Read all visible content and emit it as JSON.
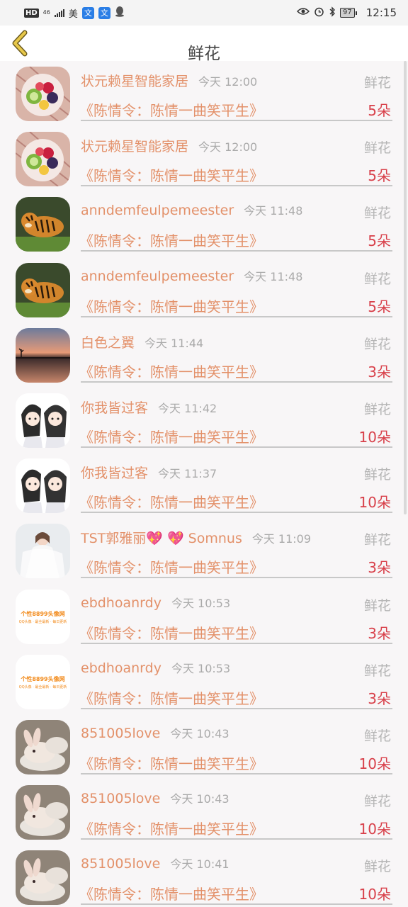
{
  "status_bar": {
    "hd": "HD",
    "net": "46",
    "carrier_text": "美",
    "app1": "文",
    "app2": "文",
    "battery": "97",
    "time": "12:15"
  },
  "header": {
    "title": "鲜花"
  },
  "type_label": "鲜花",
  "records": [
    {
      "name": "状元赖星智能家居",
      "time": "今天 12:00",
      "type": "鲜花",
      "work": "《陈情令：陈情一曲笑平生》",
      "count": "5朵",
      "avatar": "fruit"
    },
    {
      "name": "状元赖星智能家居",
      "time": "今天 12:00",
      "type": "鲜花",
      "work": "《陈情令：陈情一曲笑平生》",
      "count": "5朵",
      "avatar": "fruit"
    },
    {
      "name": "anndemfeulpemeester",
      "time": "今天 11:48",
      "type": "鲜花",
      "work": "《陈情令：陈情一曲笑平生》",
      "count": "5朵",
      "avatar": "tiger"
    },
    {
      "name": "anndemfeulpemeester",
      "time": "今天 11:48",
      "type": "鲜花",
      "work": "《陈情令：陈情一曲笑平生》",
      "count": "5朵",
      "avatar": "tiger"
    },
    {
      "name": "白色之翼",
      "time": "今天 11:44",
      "type": "鲜花",
      "work": "《陈情令：陈情一曲笑平生》",
      "count": "3朵",
      "avatar": "sunset"
    },
    {
      "name": "你我皆过客",
      "time": "今天 11:42",
      "type": "鲜花",
      "work": "《陈情令：陈情一曲笑平生》",
      "count": "10朵",
      "avatar": "anime"
    },
    {
      "name": "你我皆过客",
      "time": "今天 11:37",
      "type": "鲜花",
      "work": "《陈情令：陈情一曲笑平生》",
      "count": "10朵",
      "avatar": "anime"
    },
    {
      "name": "TST郭雅丽💖 💖 Somnus",
      "time": "今天 11:09",
      "type": "鲜花",
      "work": "《陈情令：陈情一曲笑平生》",
      "count": "3朵",
      "avatar": "bride"
    },
    {
      "name": "ebdhoanrdy",
      "time": "今天 10:53",
      "type": "鲜花",
      "work": "《陈情令：陈情一曲笑平生》",
      "count": "3朵",
      "avatar": "logo"
    },
    {
      "name": "ebdhoanrdy",
      "time": "今天 10:53",
      "type": "鲜花",
      "work": "《陈情令：陈情一曲笑平生》",
      "count": "3朵",
      "avatar": "logo"
    },
    {
      "name": "851005love",
      "time": "今天 10:43",
      "type": "鲜花",
      "work": "《陈情令：陈情一曲笑平生》",
      "count": "10朵",
      "avatar": "bunny"
    },
    {
      "name": "851005love",
      "time": "今天 10:43",
      "type": "鲜花",
      "work": "《陈情令：陈情一曲笑平生》",
      "count": "10朵",
      "avatar": "bunny"
    },
    {
      "name": "851005love",
      "time": "今天 10:41",
      "type": "鲜花",
      "work": "《陈情令：陈情一曲笑平生》",
      "count": "10朵",
      "avatar": "bunny"
    }
  ],
  "logo_avatar_text": {
    "line1": "个性8899头像网",
    "line2": "QQ头像 · 最全最新 · 每日更新"
  }
}
